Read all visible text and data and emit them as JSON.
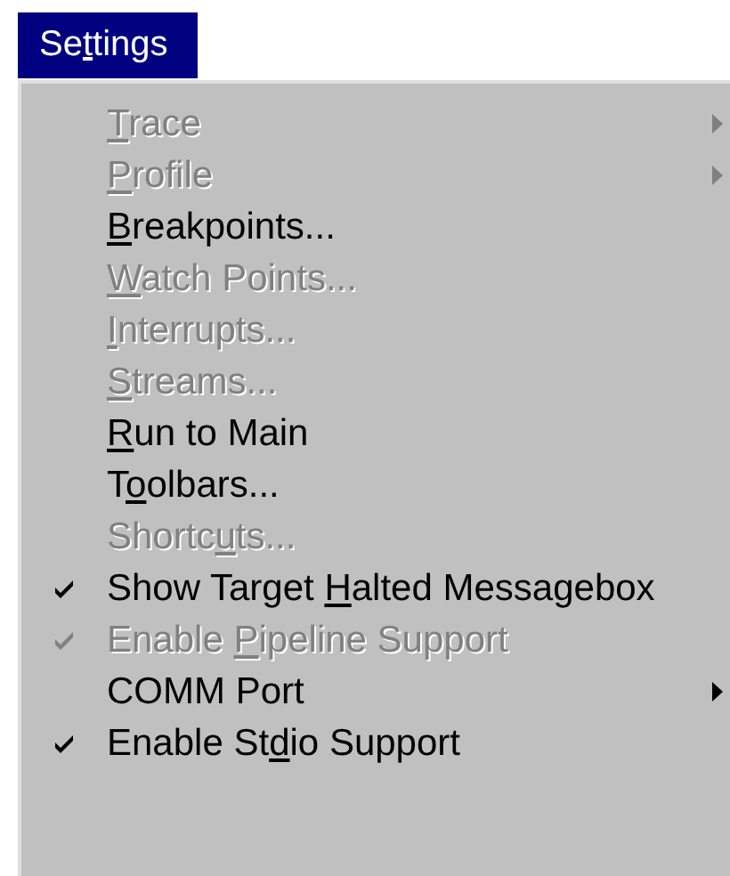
{
  "menu_title": {
    "start": "Se",
    "access_key": "t",
    "end": "tings"
  },
  "items": [
    {
      "access_key": "T",
      "end": "race",
      "disabled": true,
      "checked": false,
      "submenu": true
    },
    {
      "access_key": "P",
      "end": "rofile",
      "disabled": true,
      "checked": false,
      "submenu": true
    },
    {
      "access_key": "B",
      "end": "reakpoints...",
      "disabled": false,
      "checked": false,
      "submenu": false
    },
    {
      "access_key": "W",
      "end": "atch Points...",
      "disabled": true,
      "checked": false,
      "submenu": false
    },
    {
      "access_key": "I",
      "end": "nterrupts...",
      "disabled": true,
      "checked": false,
      "submenu": false
    },
    {
      "access_key": "S",
      "end": "treams...",
      "disabled": true,
      "checked": false,
      "submenu": false
    },
    {
      "access_key": "R",
      "end": "un to Main",
      "disabled": false,
      "checked": false,
      "submenu": false
    },
    {
      "start": "T",
      "access_key": "o",
      "end": "olbars...",
      "disabled": false,
      "checked": false,
      "submenu": false
    },
    {
      "start": "Shortc",
      "access_key": "u",
      "end": "ts...",
      "disabled": true,
      "checked": false,
      "submenu": false
    },
    {
      "start": "Show Target ",
      "access_key": "H",
      "end": "alted Messagebox",
      "disabled": false,
      "checked": true,
      "submenu": false
    },
    {
      "start": "Enable ",
      "access_key": "P",
      "end": "ipeline Support",
      "disabled": true,
      "checked": true,
      "submenu": false
    },
    {
      "start": "COMM Port",
      "disabled": false,
      "checked": false,
      "submenu": true
    },
    {
      "start": "Enable St",
      "access_key": "d",
      "end": "io Support",
      "disabled": false,
      "checked": true,
      "submenu": false
    }
  ]
}
